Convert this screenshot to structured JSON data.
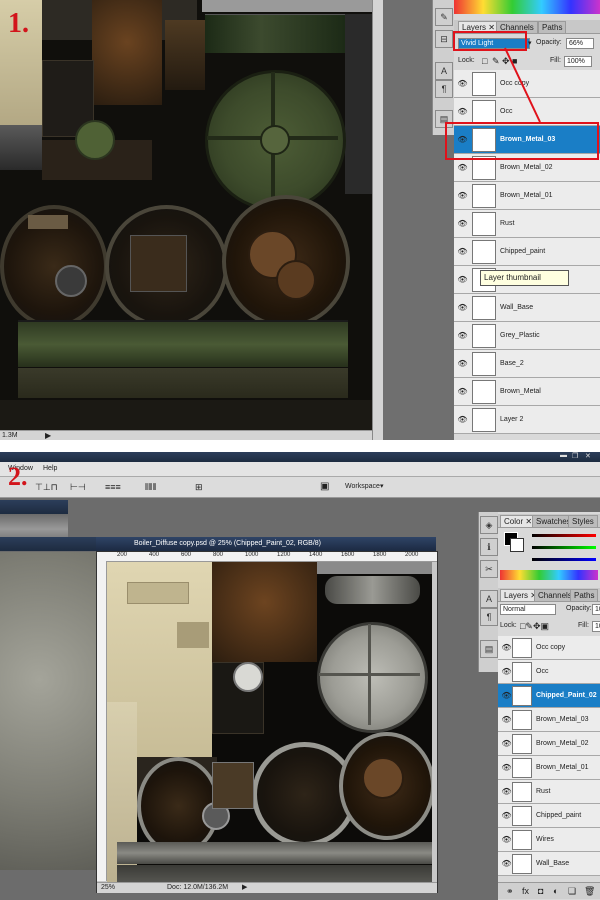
{
  "step1": {
    "label": "1.",
    "status_doc_size": "1.3M",
    "layers_panel": {
      "tabs": [
        "Layers",
        "Channels",
        "Paths"
      ],
      "blend_mode": "Vivid Light",
      "opacity_label": "Opacity:",
      "opacity_value": "66%",
      "lock_label": "Lock:",
      "fill_label": "Fill:",
      "fill_value": "100%",
      "tooltip": "Layer thumbnail",
      "layers": [
        {
          "name": "Occ copy"
        },
        {
          "name": "Occ"
        },
        {
          "name": "Brown_Metal_03",
          "selected": true
        },
        {
          "name": "Brown_Metal_02"
        },
        {
          "name": "Brown_Metal_01"
        },
        {
          "name": "Rust"
        },
        {
          "name": "Chipped_paint"
        },
        {
          "name": ""
        },
        {
          "name": "Wall_Base"
        },
        {
          "name": "Grey_Plastic"
        },
        {
          "name": "Base_2"
        },
        {
          "name": "Brown_Metal"
        },
        {
          "name": "Layer 2"
        }
      ]
    }
  },
  "step2": {
    "label": "2.",
    "menu": [
      "Window",
      "Help"
    ],
    "workspace_label": "Workspace",
    "doc_title": "Boiler_Diffuse copy.psd @ 25% (Chipped_Paint_02, RGB/8)",
    "zoom": "25%",
    "doc_size": "Doc: 12.0M/136.2M",
    "ruler_ticks": [
      "200",
      "400",
      "600",
      "800",
      "1000",
      "1200",
      "1400",
      "1600",
      "1800",
      "2000"
    ],
    "color_panel": {
      "tabs": [
        "Color",
        "Swatches",
        "Styles"
      ]
    },
    "layers_panel": {
      "tabs": [
        "Layers",
        "Channels",
        "Paths"
      ],
      "blend_mode": "Normal",
      "opacity_label": "Opacity:",
      "lock_label": "Lock:",
      "fill_label": "Fill:",
      "opacity_value": "10",
      "fill_value": "10",
      "layers": [
        {
          "name": "Occ copy"
        },
        {
          "name": "Occ"
        },
        {
          "name": "Chipped_Paint_02",
          "selected": true
        },
        {
          "name": "Brown_Metal_03"
        },
        {
          "name": "Brown_Metal_02"
        },
        {
          "name": "Brown_Metal_01"
        },
        {
          "name": "Rust"
        },
        {
          "name": "Chipped_paint"
        },
        {
          "name": "Wires"
        },
        {
          "name": "Wall_Base"
        }
      ]
    }
  },
  "icons": {
    "eye": "eye-icon",
    "lock": "lock-icon",
    "move": "move-icon",
    "brush": "brush-icon",
    "link": "link-icon",
    "trash": "trash-icon"
  },
  "colors": {
    "selection": "#1a7ec6",
    "highlight_red": "#e0121b",
    "panel_bg": "#d9d9d9"
  }
}
